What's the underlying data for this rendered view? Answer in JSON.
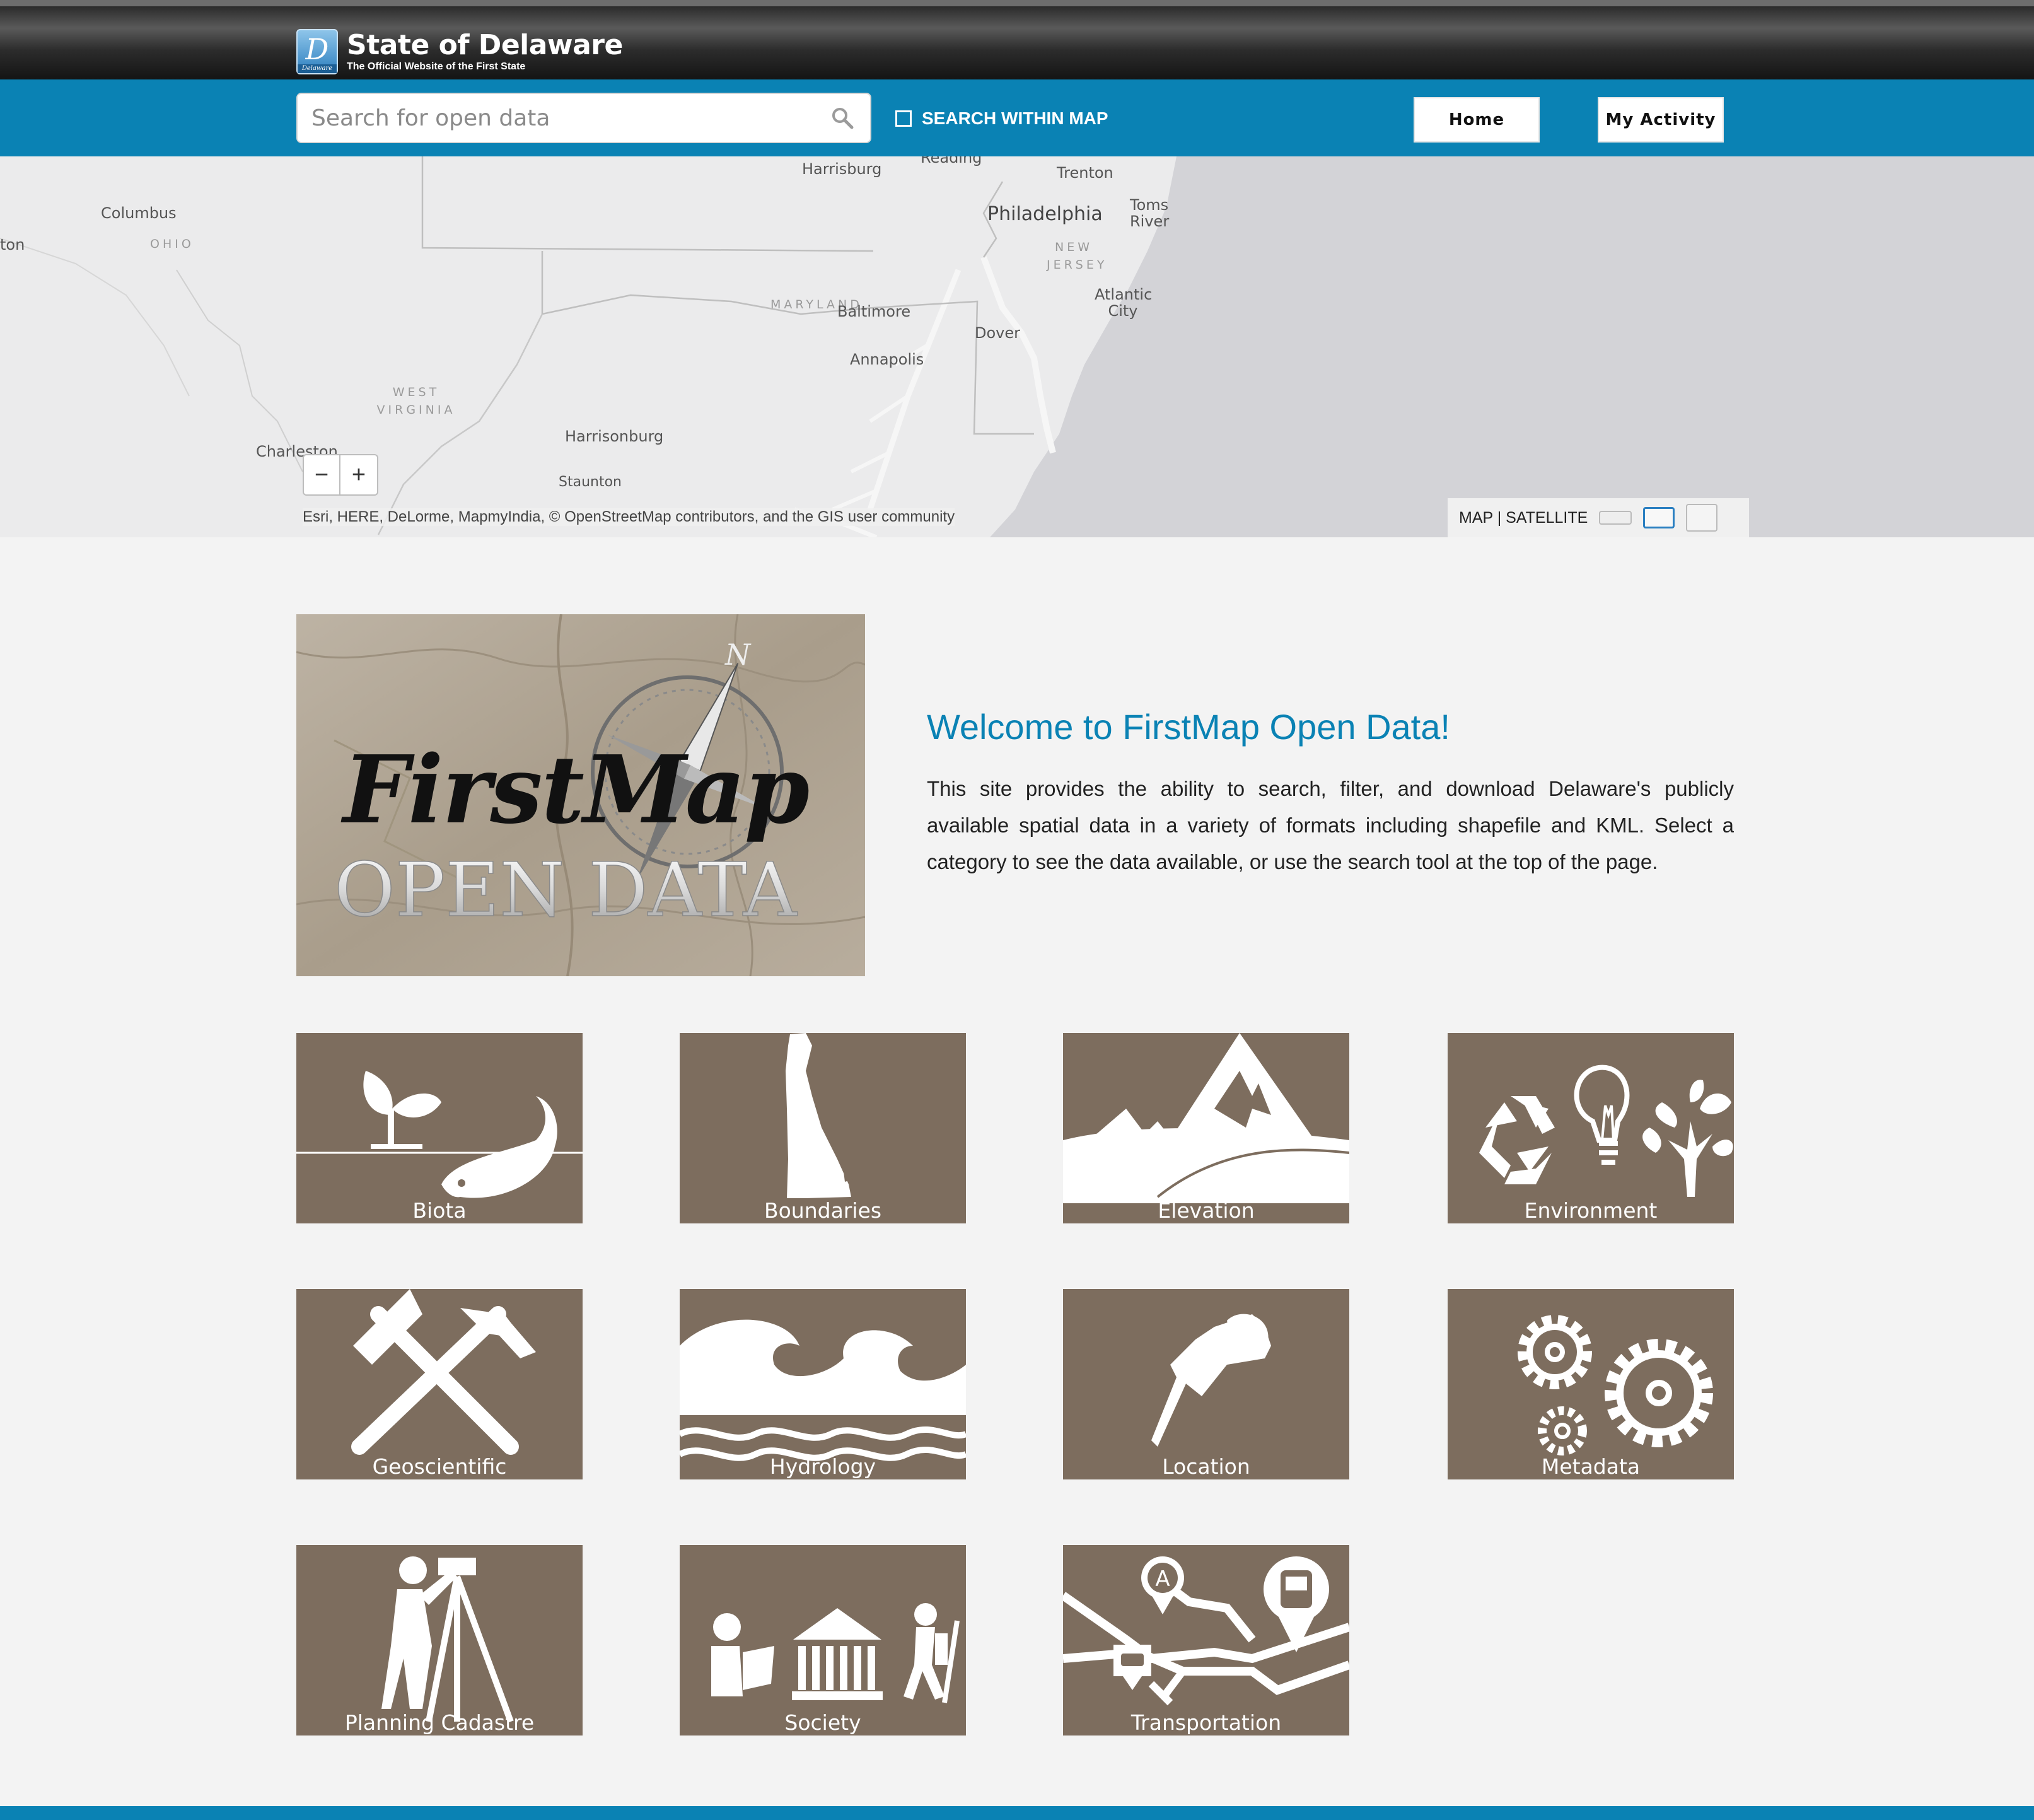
{
  "header": {
    "site_title": "State of Delaware",
    "site_subtitle": "The Official Website of the First State",
    "logo_letter": "D",
    "logo_caption": "Delaware"
  },
  "nav": {
    "search_placeholder": "Search for open data",
    "search_value": "",
    "within_map_label": "SEARCH WITHIN MAP",
    "within_map_checked": false,
    "home_label": "Home",
    "activity_label": "My Activity"
  },
  "map": {
    "labels": {
      "harrisburg": "Harrisburg",
      "reading": "Reading",
      "trenton": "Trenton",
      "philadelphia": "Philadelphia",
      "toms_river": "Toms River",
      "columbus": "Columbus",
      "dayton": "ton",
      "ohio": "OHIO",
      "new_jersey": "NEW JERSEY",
      "maryland": "MARYLAND",
      "baltimore": "Baltimore",
      "atlantic_city": "Atlantic City",
      "dover": "Dover",
      "annapolis": "Annapolis",
      "west_virginia": "WEST VIRGINIA",
      "harrisonburg": "Harrisonburg",
      "charleston": "Charleston",
      "staunton": "Staunton"
    },
    "zoom_out": "−",
    "zoom_in": "+",
    "attribution": "Esri, HERE, DeLorme, MapmyIndia, © OpenStreetMap contributors, and the GIS user community",
    "basemap_map": "MAP",
    "basemap_separator": "|",
    "basemap_satellite": "SATELLITE"
  },
  "welcome": {
    "image_title": "FirstMap",
    "image_subtitle": "OPEN DATA",
    "compass_letter": "N",
    "title": "Welcome to FirstMap Open Data!",
    "text": "This site provides the ability to search, filter, and download Delaware's publicly available spatial data in a variety of formats including shapefile and KML. Select a category to see the data available, or use the search tool at the top of the page."
  },
  "categories": [
    {
      "label": "Biota",
      "icon": "plant-fish-icon"
    },
    {
      "label": "Boundaries",
      "icon": "delaware-outline-icon"
    },
    {
      "label": "Elevation",
      "icon": "mountains-icon"
    },
    {
      "label": "Environment",
      "icon": "recycle-bulb-tree-icon"
    },
    {
      "label": "Geoscientific",
      "icon": "crossed-hammers-icon"
    },
    {
      "label": "Hydrology",
      "icon": "waves-icon"
    },
    {
      "label": "Location",
      "icon": "pushpin-icon"
    },
    {
      "label": "Metadata",
      "icon": "gears-icon"
    },
    {
      "label": "Planning Cadastre",
      "icon": "surveyor-icon"
    },
    {
      "label": "Society",
      "icon": "reader-museum-hiker-icon"
    },
    {
      "label": "Transportation",
      "icon": "map-route-icon"
    }
  ],
  "colors": {
    "brand_blue": "#0a82b4",
    "tile_brown": "#7d6d5e",
    "page_bg": "#f3f3f3"
  }
}
